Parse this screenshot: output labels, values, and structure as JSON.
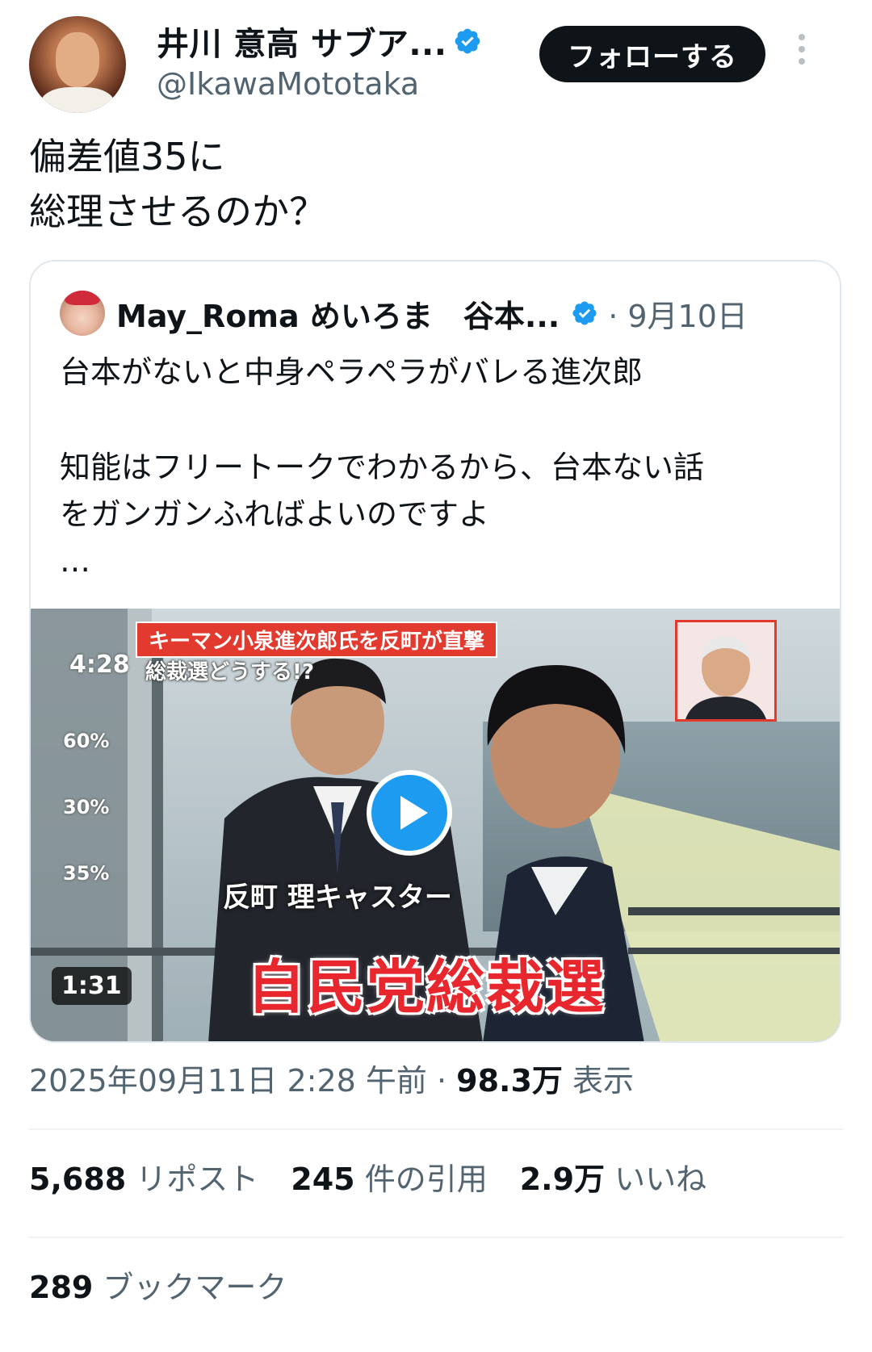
{
  "author": {
    "name": "井川 意高 サブア...",
    "handle": "@IkawaMototaka",
    "follow_label": "フォローする"
  },
  "tweet": {
    "lines": [
      "偏差値35に",
      "総理させるのか？"
    ]
  },
  "quote": {
    "name": "May_Roma めいろま　谷本...",
    "date": "· 9月10日",
    "line1": "台本がないと中身ペラペラがバレる進次郎",
    "line2": "知能はフリートークでわかるから、台本ない話",
    "line3": "をガンガンふればよいのですよ",
    "ellipsis": "…",
    "video": {
      "caption_top": "キーマン小泉進次郎氏を反町が直撃",
      "caption_sub": "総裁選どうする!?",
      "time_overlay": "4:28",
      "side_stats": [
        "60%",
        "30%",
        "35%"
      ],
      "caster": "反町 理キャスター",
      "big_caption": "自民党総裁選",
      "duration": "1:31"
    }
  },
  "meta": {
    "timestamp": "2025年09月11日 2:28 午前",
    "separator": " · ",
    "views_count": "98.3万",
    "views_label": " 表示"
  },
  "stats": {
    "reposts_count": "5,688",
    "reposts_label": " リポスト",
    "quotes_count": "245",
    "quotes_label": " 件の引用",
    "likes_count": "2.9万",
    "likes_label": " いいね",
    "bookmarks_count": "289",
    "bookmarks_label": " ブックマーク"
  },
  "colors": {
    "verified": "#1d9bf0",
    "text_primary": "#0f1419",
    "text_secondary": "#536471",
    "follow_bg": "#0f1419",
    "caption_red": "#e23a2e"
  }
}
